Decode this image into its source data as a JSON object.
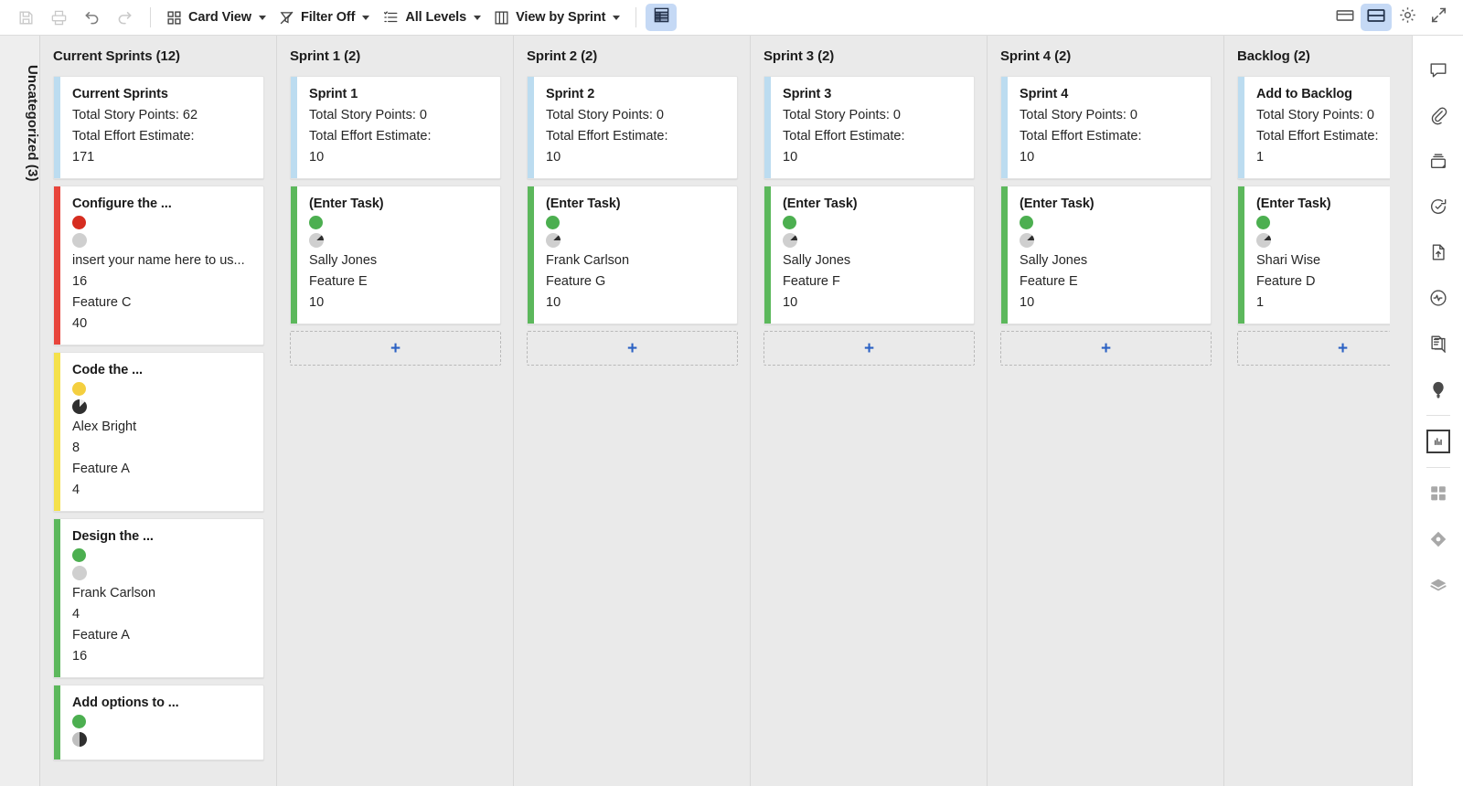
{
  "toolbar": {
    "left_icons": [
      {
        "name": "save-icon",
        "glyph": "save",
        "enabled": false
      },
      {
        "name": "print-icon",
        "glyph": "print",
        "enabled": false
      },
      {
        "name": "undo-icon",
        "glyph": "undo",
        "enabled": true
      },
      {
        "name": "redo-icon",
        "glyph": "redo",
        "enabled": false
      }
    ],
    "groups": [
      {
        "name": "card-view",
        "label": "Card View",
        "glyph": "cards",
        "caret": true
      },
      {
        "name": "filter",
        "label": "Filter Off",
        "glyph": "funnel-off",
        "caret": true
      },
      {
        "name": "levels",
        "label": "All Levels",
        "glyph": "levels-list",
        "caret": true
      },
      {
        "name": "view-by",
        "label": "View by Sprint",
        "glyph": "table-columns",
        "caret": true
      }
    ],
    "grid_toggle": {
      "name": "grid-table-toggle",
      "glyph": "table-grid",
      "active": true
    },
    "right_toggles": [
      {
        "name": "single-pane-layout",
        "glyph": "pane-single",
        "active": false
      },
      {
        "name": "split-pane-layout",
        "glyph": "pane-split",
        "active": true
      },
      {
        "name": "settings-gear",
        "glyph": "gear",
        "active": false
      },
      {
        "name": "collapse-arrows",
        "glyph": "collapse",
        "active": false
      }
    ]
  },
  "swimlane": {
    "label": "Uncategorized (3)"
  },
  "colors": {
    "accent_blue": "#2c62c4",
    "toggle_active_bg": "#c5d9f5",
    "stripe_summary": "#bcdcf0",
    "stripe_red": "#e8453c",
    "stripe_yellow": "#f5e14b",
    "stripe_green": "#5cb85c",
    "dot_red": "#d62d20",
    "dot_yellow": "#f4cf3f",
    "dot_green": "#4caf50",
    "dot_gray": "#cccccc",
    "board_bg": "#eaeaea",
    "card_bg": "#ffffff"
  },
  "columns": [
    {
      "name": "column-current-sprints",
      "header": "Current Sprints (12)",
      "summary": {
        "title": "Current Sprints",
        "story_points_line": "Total Story Points: 62",
        "effort_label": "Total Effort Estimate:",
        "effort_value": "171"
      },
      "cards": [
        {
          "title": "Configure the ...",
          "stripe": "red",
          "dot": "red",
          "pie": "empty",
          "lines": [
            "insert your name here to us...",
            "16",
            "Feature C",
            "40"
          ]
        },
        {
          "title": "Code the ...",
          "stripe": "yellow",
          "dot": "yellow",
          "pie": "quarter-dark",
          "lines": [
            "Alex Bright",
            "8",
            "Feature A",
            "4"
          ]
        },
        {
          "title": "Design the ...",
          "stripe": "green",
          "dot": "green",
          "pie": "empty",
          "lines": [
            "Frank Carlson",
            "4",
            "Feature A",
            "16"
          ]
        },
        {
          "title": "Add options to ...",
          "stripe": "green",
          "dot": "green",
          "pie": "half-dark",
          "lines": []
        }
      ],
      "add_slot": false
    },
    {
      "name": "column-sprint-1",
      "header": "Sprint 1 (2)",
      "summary": {
        "title": "Sprint 1",
        "story_points_line": "Total Story Points: 0",
        "effort_label": "Total Effort Estimate:",
        "effort_value": "10"
      },
      "cards": [
        {
          "title": "(Enter Task)",
          "stripe": "green",
          "dot": "green",
          "pie": "sliver",
          "lines": [
            "Sally Jones",
            "Feature E",
            "10"
          ]
        }
      ],
      "add_slot": true
    },
    {
      "name": "column-sprint-2",
      "header": "Sprint 2 (2)",
      "summary": {
        "title": "Sprint 2",
        "story_points_line": "Total Story Points: 0",
        "effort_label": "Total Effort Estimate:",
        "effort_value": "10"
      },
      "cards": [
        {
          "title": "(Enter Task)",
          "stripe": "green",
          "dot": "green",
          "pie": "sliver",
          "lines": [
            "Frank Carlson",
            "Feature G",
            "10"
          ]
        }
      ],
      "add_slot": true
    },
    {
      "name": "column-sprint-3",
      "header": "Sprint 3 (2)",
      "summary": {
        "title": "Sprint 3",
        "story_points_line": "Total Story Points: 0",
        "effort_label": "Total Effort Estimate:",
        "effort_value": "10"
      },
      "cards": [
        {
          "title": "(Enter Task)",
          "stripe": "green",
          "dot": "green",
          "pie": "sliver",
          "lines": [
            "Sally Jones",
            "Feature F",
            "10"
          ]
        }
      ],
      "add_slot": true
    },
    {
      "name": "column-sprint-4",
      "header": "Sprint 4 (2)",
      "summary": {
        "title": "Sprint 4",
        "story_points_line": "Total Story Points: 0",
        "effort_label": "Total Effort Estimate:",
        "effort_value": "10"
      },
      "cards": [
        {
          "title": "(Enter Task)",
          "stripe": "green",
          "dot": "green",
          "pie": "sliver",
          "lines": [
            "Sally Jones",
            "Feature E",
            "10"
          ]
        }
      ],
      "add_slot": true
    },
    {
      "name": "column-backlog",
      "header": "Backlog (2)",
      "summary": {
        "title": "Add to Backlog",
        "story_points_line": "Total Story Points: 0",
        "effort_label": "Total Effort Estimate:",
        "effort_value": "1"
      },
      "cards": [
        {
          "title": "(Enter Task)",
          "stripe": "green",
          "dot": "green",
          "pie": "sliver",
          "lines": [
            "Shari Wise",
            "Feature D",
            "1"
          ]
        }
      ],
      "add_slot": true
    }
  ],
  "right_rail": [
    {
      "name": "comments-icon",
      "glyph": "speech-bubble",
      "boxed": false,
      "muted": false
    },
    {
      "name": "attachment-icon",
      "glyph": "paperclip",
      "boxed": false,
      "muted": false
    },
    {
      "name": "archive-icon",
      "glyph": "tray",
      "boxed": false,
      "muted": false
    },
    {
      "name": "refresh-check-icon",
      "glyph": "sync-check",
      "boxed": false,
      "muted": false
    },
    {
      "name": "upload-document-icon",
      "glyph": "doc-upload",
      "boxed": false,
      "muted": false
    },
    {
      "name": "activity-icon",
      "glyph": "pulse-circle",
      "boxed": false,
      "muted": false
    },
    {
      "name": "notes-icon",
      "glyph": "note-pages",
      "boxed": false,
      "muted": false
    },
    {
      "name": "balloon-icon",
      "glyph": "balloon",
      "boxed": false,
      "muted": false
    },
    {
      "name": "chart-report-icon",
      "glyph": "bar-chart-box",
      "boxed": true,
      "muted": false
    },
    {
      "name": "dashboard-grid-icon",
      "glyph": "grid-four",
      "boxed": false,
      "muted": true
    },
    {
      "name": "diamond-icon",
      "glyph": "diamond",
      "boxed": false,
      "muted": true
    },
    {
      "name": "layers-icon",
      "glyph": "stack",
      "boxed": false,
      "muted": true
    }
  ]
}
